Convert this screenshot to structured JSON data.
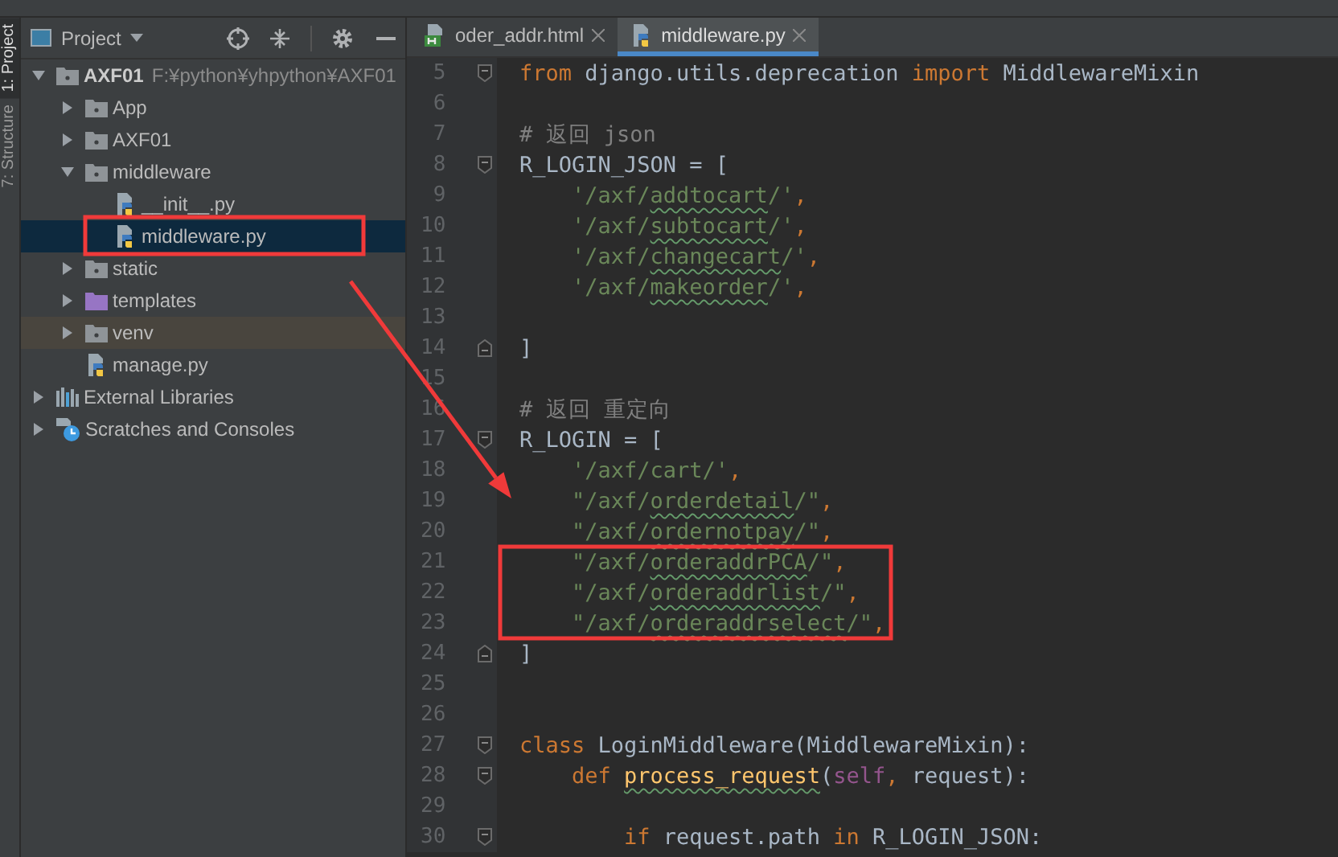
{
  "side_strip": [
    {
      "label": "1: Project",
      "selected": true
    },
    {
      "label": "7: Structure",
      "selected": false
    }
  ],
  "project_panel": {
    "title": "Project",
    "tree": [
      {
        "label": "AXF01",
        "path": "F:¥python¥yhpython¥AXF01",
        "kind": "folder",
        "expanded": true,
        "selected": false,
        "excluded": false,
        "children": [
          {
            "label": "App",
            "kind": "folder",
            "expanded": false,
            "selected": false,
            "excluded": false
          },
          {
            "label": "AXF01",
            "kind": "folder",
            "expanded": false,
            "selected": false,
            "excluded": false
          },
          {
            "label": "middleware",
            "kind": "folder",
            "expanded": true,
            "selected": false,
            "excluded": false,
            "children": [
              {
                "label": "__init__.py",
                "kind": "python",
                "selected": false,
                "excluded": false
              },
              {
                "label": "middleware.py",
                "kind": "python",
                "selected": true,
                "excluded": false
              }
            ]
          },
          {
            "label": "static",
            "kind": "folder",
            "expanded": false,
            "selected": false,
            "excluded": false
          },
          {
            "label": "templates",
            "kind": "template-folder",
            "expanded": false,
            "selected": false,
            "excluded": false
          },
          {
            "label": "venv",
            "kind": "folder",
            "expanded": false,
            "selected": false,
            "excluded": true
          },
          {
            "label": "manage.py",
            "kind": "python",
            "selected": false,
            "excluded": false
          }
        ]
      },
      {
        "label": "External Libraries",
        "kind": "library",
        "expanded": false,
        "selected": false,
        "excluded": false
      },
      {
        "label": "Scratches and Consoles",
        "kind": "scratches",
        "expanded": false,
        "selected": false,
        "excluded": false
      }
    ]
  },
  "editor": {
    "tabs": [
      {
        "label": "oder_addr.html",
        "kind": "html",
        "selected": false
      },
      {
        "label": "middleware.py",
        "kind": "python",
        "selected": true
      }
    ],
    "lines": [
      {
        "number": "5",
        "kind": "fold-start",
        "segments": [
          {
            "text": "from",
            "kind": "kw"
          },
          {
            "text": " django.utils.deprecation ",
            "kind": "plain"
          },
          {
            "text": "import",
            "kind": "kw"
          },
          {
            "text": " MiddlewareMixin",
            "kind": "plain"
          }
        ]
      },
      {
        "number": "6",
        "kind": "plain"
      },
      {
        "number": "7",
        "kind": "plain",
        "segments": [
          {
            "text": "# 返回 json",
            "kind": "comment"
          }
        ]
      },
      {
        "number": "8",
        "kind": "fold-start",
        "segments": [
          {
            "text": "R_LOGIN_JSON = [",
            "kind": "plain"
          }
        ]
      },
      {
        "number": "9",
        "kind": "plain",
        "segments": [
          {
            "text": "    '/axf/",
            "kind": "str"
          },
          {
            "text": "addtocart",
            "kind": "typo"
          },
          {
            "text": "/'",
            "kind": "str"
          },
          {
            "text": ",",
            "kind": "punct"
          }
        ]
      },
      {
        "number": "10",
        "kind": "plain",
        "segments": [
          {
            "text": "    '/axf/",
            "kind": "str"
          },
          {
            "text": "subtocart",
            "kind": "typo"
          },
          {
            "text": "/'",
            "kind": "str"
          },
          {
            "text": ",",
            "kind": "punct"
          }
        ]
      },
      {
        "number": "11",
        "kind": "plain",
        "segments": [
          {
            "text": "    '/axf/",
            "kind": "str"
          },
          {
            "text": "changecart",
            "kind": "typo"
          },
          {
            "text": "/'",
            "kind": "str"
          },
          {
            "text": ",",
            "kind": "punct"
          }
        ]
      },
      {
        "number": "12",
        "kind": "plain",
        "segments": [
          {
            "text": "    '/axf/",
            "kind": "str"
          },
          {
            "text": "makeorder",
            "kind": "typo"
          },
          {
            "text": "/'",
            "kind": "str"
          },
          {
            "text": ",",
            "kind": "punct"
          }
        ]
      },
      {
        "number": "13",
        "kind": "plain"
      },
      {
        "number": "14",
        "kind": "fold-end",
        "segments": [
          {
            "text": "]",
            "kind": "plain"
          }
        ]
      },
      {
        "number": "15",
        "kind": "plain"
      },
      {
        "number": "16",
        "kind": "plain",
        "segments": [
          {
            "text": "# 返回 重定向",
            "kind": "comment"
          }
        ]
      },
      {
        "number": "17",
        "kind": "fold-start",
        "segments": [
          {
            "text": "R_LOGIN = [",
            "kind": "plain"
          }
        ]
      },
      {
        "number": "18",
        "kind": "plain",
        "segments": [
          {
            "text": "    '/axf/cart/'",
            "kind": "str"
          },
          {
            "text": ",",
            "kind": "punct"
          }
        ]
      },
      {
        "number": "19",
        "kind": "plain",
        "segments": [
          {
            "text": "    \"/axf/",
            "kind": "str"
          },
          {
            "text": "orderdetail",
            "kind": "typo"
          },
          {
            "text": "/\"",
            "kind": "str"
          },
          {
            "text": ",",
            "kind": "punct"
          }
        ]
      },
      {
        "number": "20",
        "kind": "plain",
        "segments": [
          {
            "text": "    \"/axf/",
            "kind": "str"
          },
          {
            "text": "ordernotpay",
            "kind": "typo"
          },
          {
            "text": "/\"",
            "kind": "str"
          },
          {
            "text": ",",
            "kind": "punct"
          }
        ]
      },
      {
        "number": "21",
        "kind": "plain",
        "segments": [
          {
            "text": "    \"/axf/",
            "kind": "str"
          },
          {
            "text": "orderaddrPCA",
            "kind": "typo"
          },
          {
            "text": "/\"",
            "kind": "str"
          },
          {
            "text": ",",
            "kind": "punct"
          }
        ]
      },
      {
        "number": "22",
        "kind": "plain",
        "segments": [
          {
            "text": "    \"/axf/",
            "kind": "str"
          },
          {
            "text": "orderaddrlist",
            "kind": "typo"
          },
          {
            "text": "/\"",
            "kind": "str"
          },
          {
            "text": ",",
            "kind": "punct"
          }
        ]
      },
      {
        "number": "23",
        "kind": "plain",
        "segments": [
          {
            "text": "    \"/axf/",
            "kind": "str"
          },
          {
            "text": "orderaddrselect",
            "kind": "typo"
          },
          {
            "text": "/\"",
            "kind": "str"
          },
          {
            "text": ",",
            "kind": "punct"
          }
        ]
      },
      {
        "number": "24",
        "kind": "fold-end",
        "segments": [
          {
            "text": "]",
            "kind": "plain"
          }
        ]
      },
      {
        "number": "25",
        "kind": "plain"
      },
      {
        "number": "26",
        "kind": "plain"
      },
      {
        "number": "27",
        "kind": "fold-start",
        "segments": [
          {
            "text": "class",
            "kind": "kw"
          },
          {
            "text": " LoginMiddleware(MiddlewareMixin):",
            "kind": "plain"
          }
        ]
      },
      {
        "number": "28",
        "kind": "fold-start",
        "segments": [
          {
            "text": "    def ",
            "kind": "kw"
          },
          {
            "text": "process_request",
            "kind": "fn"
          },
          {
            "text": "(",
            "kind": "plain"
          },
          {
            "text": "self",
            "kind": "self"
          },
          {
            "text": ",",
            "kind": "punct"
          },
          {
            "text": " request):",
            "kind": "plain"
          }
        ]
      },
      {
        "number": "29",
        "kind": "plain"
      },
      {
        "number": "30",
        "kind": "fold-start",
        "segments": [
          {
            "text": "        if",
            "kind": "kw"
          },
          {
            "text": " request.path ",
            "kind": "plain"
          },
          {
            "text": "in",
            "kind": "kw"
          },
          {
            "text": " R_LOGIN_JSON:",
            "kind": "plain"
          }
        ]
      }
    ]
  }
}
